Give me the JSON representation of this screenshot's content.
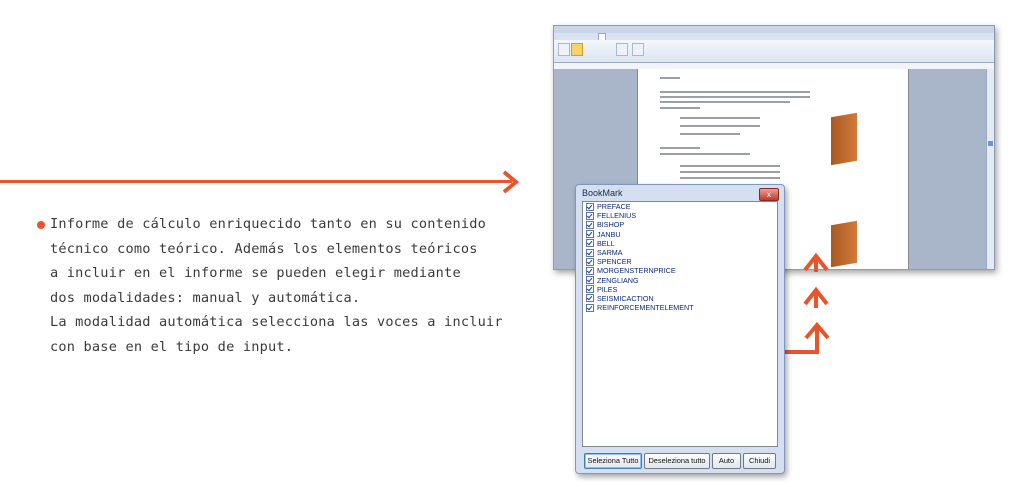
{
  "description": {
    "lines": [
      "Informe de cálculo enriquecido tanto en su contenido",
      "técnico como teórico. Además los elementos teóricos",
      "a incluir en el informe se pueden elegir mediante",
      "dos modalidades: manual y automática.",
      "La modalidad automática selecciona las voces a incluir",
      "con base en el tipo de input."
    ]
  },
  "accent_color": "#e8542b",
  "bookmark_dialog": {
    "title": "BookMark",
    "close_label": "x",
    "items": [
      {
        "label": "PREFACE",
        "checked": true
      },
      {
        "label": "FELLENIUS",
        "checked": true
      },
      {
        "label": "BISHOP",
        "checked": true
      },
      {
        "label": "JANBU",
        "checked": true
      },
      {
        "label": "BELL",
        "checked": true
      },
      {
        "label": "SARMA",
        "checked": true
      },
      {
        "label": "SPENCER",
        "checked": true
      },
      {
        "label": "MORGENSTERNPRICE",
        "checked": true
      },
      {
        "label": "ZENGLIANG",
        "checked": true
      },
      {
        "label": "PILES",
        "checked": true
      },
      {
        "label": "SEISMICACTION",
        "checked": true
      },
      {
        "label": "REINFORCEMENTELEMENT",
        "checked": true
      }
    ],
    "buttons": {
      "select_all": "Seleziona Tutto",
      "deselect_all": "Deseleziona tutto",
      "auto": "Auto",
      "close": "Chiudi"
    }
  },
  "icons": [
    "arrow-right-icon",
    "arrow-up-icon",
    "checkbox-checked-icon",
    "close-icon"
  ]
}
